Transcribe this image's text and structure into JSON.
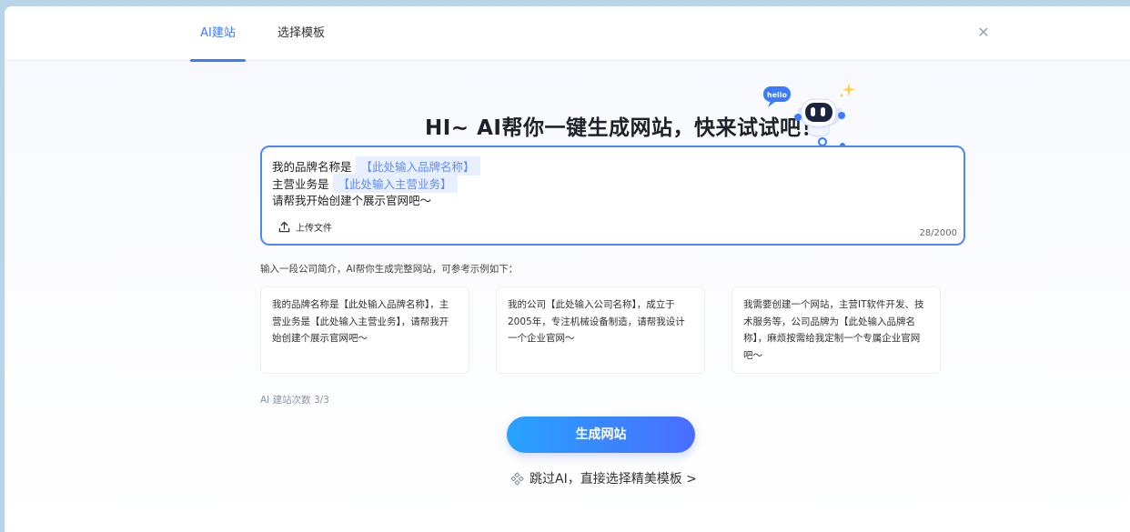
{
  "tabs": [
    {
      "label": "AI建站"
    },
    {
      "label": "选择模板"
    }
  ],
  "close_icon": "close-icon",
  "headline": "HI~ AI帮你一键生成网站，快来试试吧！",
  "robot": {
    "bubble_text": "hello"
  },
  "prompt": {
    "line1_prefix": "我的品牌名称是",
    "line1_placeholder": "【此处输入品牌名称】",
    "line2_prefix": "主营业务是",
    "line2_placeholder": "【此处输入主营业务】",
    "line3": "请帮我开始创建个展示官网吧～",
    "upload_label": "上传文件",
    "counter": "28/2000"
  },
  "hint": "输入一段公司简介，AI帮你生成完整网站，可参考示例如下：",
  "examples": [
    "我的品牌名称是【此处输入品牌名称】，主营业务是【此处输入主营业务】，请帮我开始创建个展示官网吧～",
    "我的公司【此处输入公司名称】，成立于2005年，专注机械设备制造，请帮我设计一个企业官网～",
    "我需要创建一个网站，主营IT软件开发、技术服务等，公司品牌为【此处输入品牌名称】，麻烦按需给我定制一个专属企业官网吧～"
  ],
  "build_count": "AI 建站次数 3/3",
  "generate_button": "生成网站",
  "skip_link": "跳过AI，直接选择精美模板 >",
  "colors": {
    "accent": "#3a7bff",
    "button_start": "#27a3ff",
    "button_end": "#4a6dff",
    "backdrop": "#b9d4e6"
  }
}
